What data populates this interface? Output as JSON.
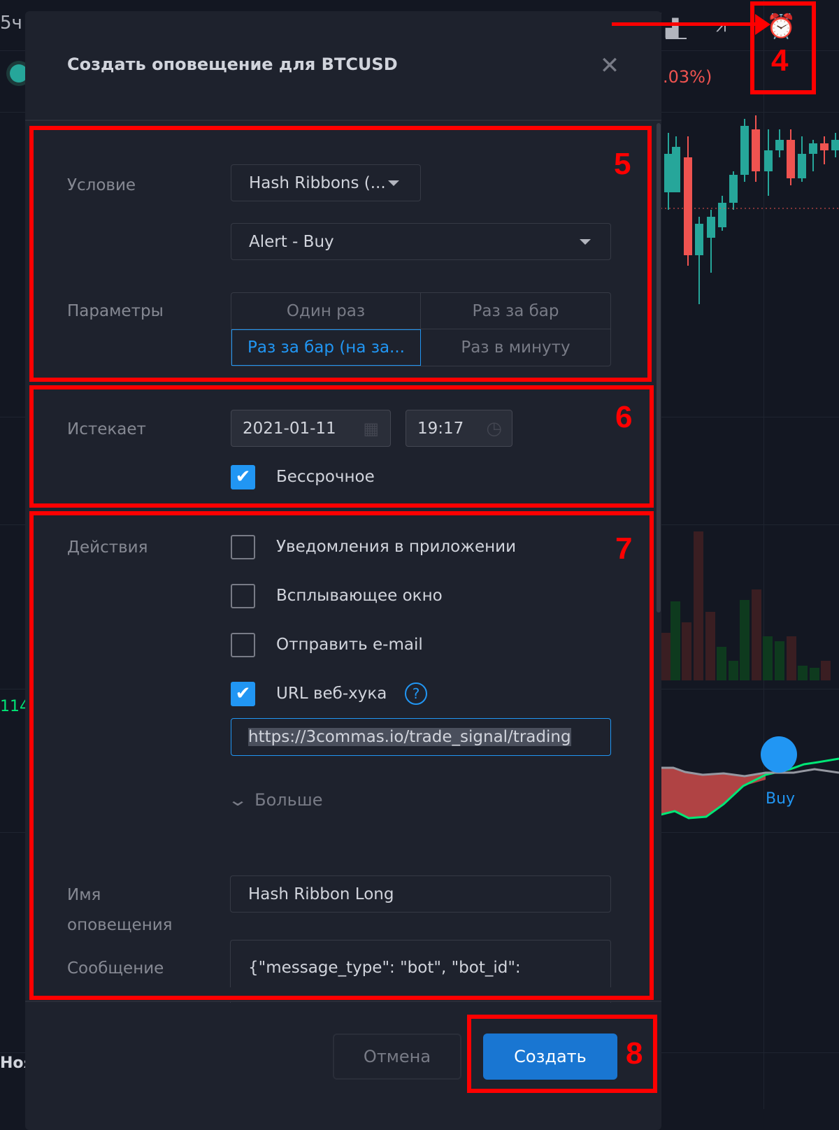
{
  "background": {
    "left_timeframe": "5ч",
    "change_percent": ".03%)",
    "indicator_value": "114",
    "month_label": "Ноя",
    "buy_label": "Buy"
  },
  "dialog": {
    "title": "Создать оповещение для BTCUSD",
    "condition": {
      "label": "Условие",
      "indicator": "Hash Ribbons (...",
      "signal": "Alert - Buy"
    },
    "params": {
      "label": "Параметры",
      "options": [
        "Один раз",
        "Раз за бар",
        "Раз за бар (на за...",
        "Раз в минуту"
      ],
      "selected": "Раз за бар (на за..."
    },
    "expires": {
      "label": "Истекает",
      "date": "2021-01-11",
      "time": "19:17",
      "unlimited_label": "Бессрочное",
      "unlimited_checked": true
    },
    "actions": {
      "label": "Действия",
      "items": [
        {
          "label": "Уведомления в приложении",
          "checked": false
        },
        {
          "label": "Всплывающее окно",
          "checked": false
        },
        {
          "label": "Отправить e-mail",
          "checked": false
        },
        {
          "label": "URL веб-хука",
          "checked": true
        }
      ],
      "webhook_url": "https://3commas.io/trade_signal/trading",
      "more_label": "Больше"
    },
    "name": {
      "label_line1": "Имя",
      "label_line2": "оповещения",
      "value": "Hash Ribbon Long"
    },
    "message": {
      "label": "Сообщение",
      "value": "{\"message_type\": \"bot\",  \"bot_id\":"
    },
    "cancel_label": "Отмена",
    "create_label": "Создать"
  },
  "annotations": [
    "4",
    "5",
    "6",
    "7",
    "8"
  ],
  "colors": {
    "accent": "#2196f3",
    "create_button": "#1976d2",
    "annotation": "#ff0000",
    "up": "#26a69a",
    "down": "#ef5350"
  }
}
